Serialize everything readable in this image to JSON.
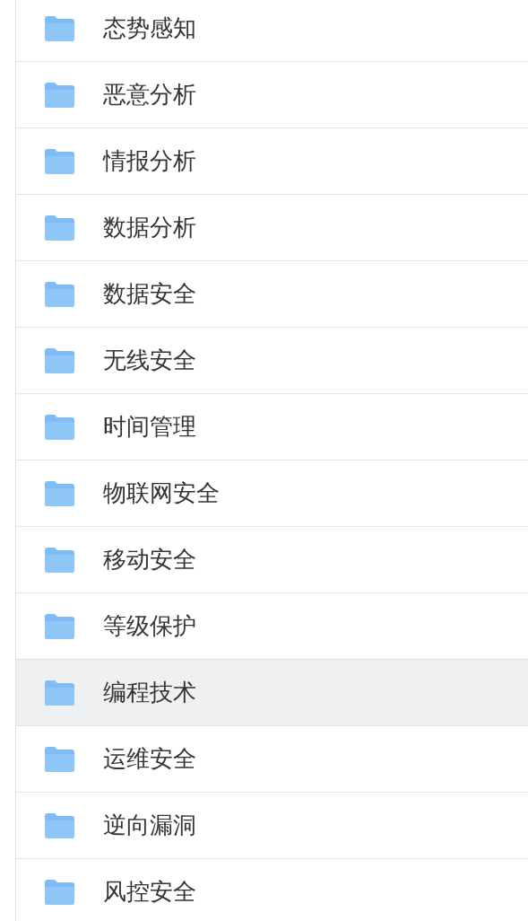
{
  "folders": [
    {
      "name": "态势感知",
      "selected": false
    },
    {
      "name": "恶意分析",
      "selected": false
    },
    {
      "name": "情报分析",
      "selected": false
    },
    {
      "name": "数据分析",
      "selected": false
    },
    {
      "name": "数据安全",
      "selected": false
    },
    {
      "name": "无线安全",
      "selected": false
    },
    {
      "name": "时间管理",
      "selected": false
    },
    {
      "name": "物联网安全",
      "selected": false
    },
    {
      "name": "移动安全",
      "selected": false
    },
    {
      "name": "等级保护",
      "selected": false
    },
    {
      "name": "编程技术",
      "selected": true
    },
    {
      "name": "运维安全",
      "selected": false
    },
    {
      "name": "逆向漏洞",
      "selected": false
    },
    {
      "name": "风控安全",
      "selected": false
    }
  ]
}
